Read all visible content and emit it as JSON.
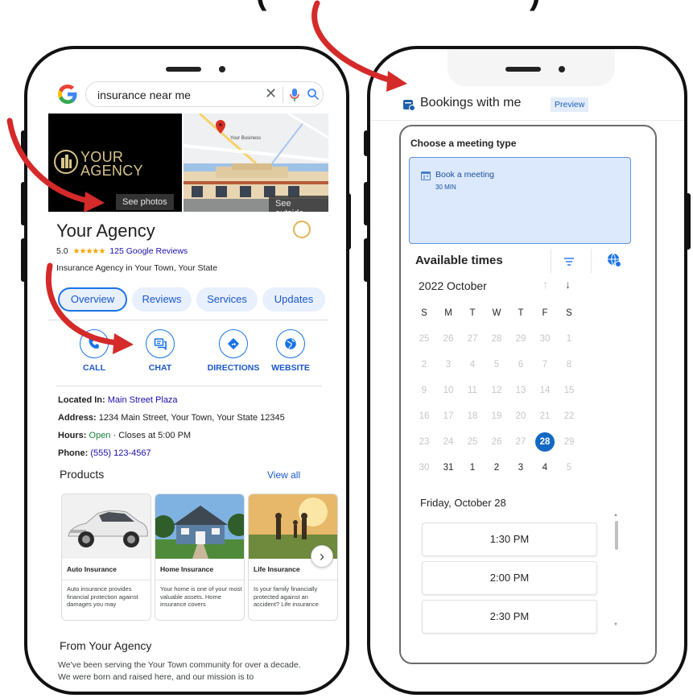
{
  "left_phone": {
    "search": {
      "query": "insurance near me",
      "clear_glyph": "✕"
    },
    "photos": {
      "logo_line1": "YOUR",
      "logo_line2": "AGENCY",
      "see_photos_label": "See photos",
      "map_marker_label": "Your Business",
      "see_outside_label": "See outside"
    },
    "business": {
      "name": "Your Agency",
      "rating": "5.0",
      "stars": "★★★★★",
      "reviews": "125 Google Reviews",
      "category": "Insurance Agency in Your Town, Your State"
    },
    "tabs": [
      {
        "label": "Overview"
      },
      {
        "label": "Reviews"
      },
      {
        "label": "Services"
      },
      {
        "label": "Updates"
      }
    ],
    "actions": [
      {
        "label": "CALL",
        "icon": "phone-icon"
      },
      {
        "label": "CHAT",
        "icon": "chat-icon"
      },
      {
        "label": "DIRECTIONS",
        "icon": "directions-icon"
      },
      {
        "label": "WEBSITE",
        "icon": "globe-icon"
      }
    ],
    "info": {
      "located_key": "Located In:",
      "located_val": "Main Street Plaza",
      "address_key": "Address:",
      "address_val": "1234 Main Street, Your Town, Your State 12345",
      "hours_key": "Hours:",
      "hours_open": "Open",
      "hours_rest": "· Closes at 5:00 PM",
      "phone_key": "Phone:",
      "phone_val": "(555) 123-4567"
    },
    "products": {
      "title": "Products",
      "view_all": "View all",
      "items": [
        {
          "title": "Auto Insurance",
          "desc": "Auto insurance provides financial protection against damages you may"
        },
        {
          "title": "Home Insurance",
          "desc": "Your home is one of your most valuable assets. Home insurance covers"
        },
        {
          "title": "Life Insurance",
          "desc": "Is your family financially protected against an accident? Life insurance"
        }
      ],
      "next_glyph": "›"
    },
    "from": {
      "title": "From Your Agency",
      "text": "We've been serving the Your Town community for over a decade. We were born and raised here, and our mission is to"
    }
  },
  "right_phone": {
    "header": {
      "title": "Bookings with me",
      "badge": "Preview"
    },
    "meeting": {
      "label": "Choose a meeting type",
      "name": "Book a meeting",
      "duration": "30 MIN"
    },
    "availability": {
      "title": "Available times",
      "month": "2022 October",
      "up_glyph": "↑",
      "down_glyph": "↓",
      "weekdays": [
        "S",
        "M",
        "T",
        "W",
        "T",
        "F",
        "S"
      ],
      "weeks": [
        [
          "25",
          "26",
          "27",
          "28",
          "29",
          "30",
          "1"
        ],
        [
          "2",
          "3",
          "4",
          "5",
          "6",
          "7",
          "8"
        ],
        [
          "9",
          "10",
          "11",
          "12",
          "13",
          "14",
          "15"
        ],
        [
          "16",
          "17",
          "18",
          "19",
          "20",
          "21",
          "22"
        ],
        [
          "23",
          "24",
          "25",
          "26",
          "27",
          "28",
          "29"
        ],
        [
          "30",
          "31",
          "1",
          "2",
          "3",
          "4",
          "5"
        ]
      ],
      "selected_day": "28",
      "day_label": "Friday, October 28",
      "slots": [
        "1:30 PM",
        "2:00 PM",
        "2:30 PM"
      ]
    }
  },
  "colors": {
    "google_blue": "#1a73e8",
    "link_blue": "#1a0dab",
    "open_green": "#188038",
    "booking_blue": "#1368c4",
    "arrow_red": "#d42a2a"
  }
}
